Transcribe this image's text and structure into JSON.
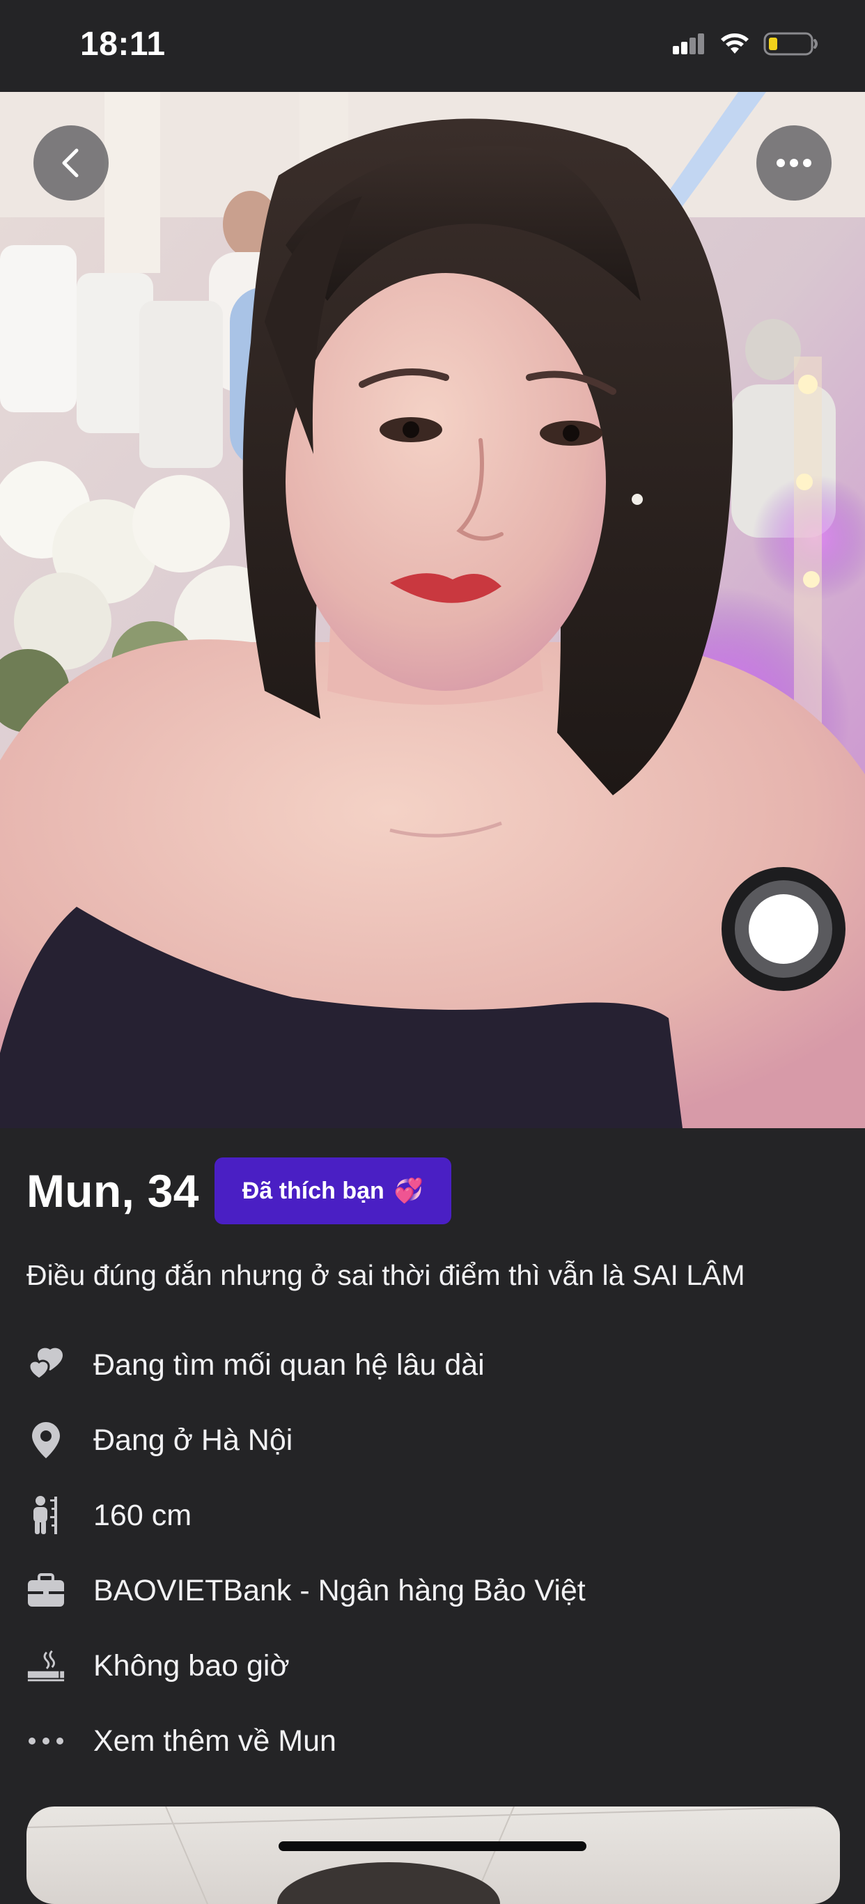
{
  "status_bar": {
    "time": "18:11"
  },
  "photo": {
    "back_icon": "chevron-left-icon",
    "more_icon": "ellipsis-icon"
  },
  "profile": {
    "name_age": "Mun, 34",
    "liked_badge": "Đã thích bạn",
    "liked_badge_emoji": "💞",
    "bio": "Điều đúng đắn nhưng ở sai thời điểm thì vẫn là SAI LÂM",
    "details": [
      {
        "icon": "hearts-icon",
        "text": "Đang tìm mối quan hệ lâu dài"
      },
      {
        "icon": "location-pin-icon",
        "text": "Đang ở Hà Nội"
      },
      {
        "icon": "height-icon",
        "text": "160 cm"
      },
      {
        "icon": "briefcase-icon",
        "text": "BAOVIETBank - Ngân hàng Bảo Việt"
      },
      {
        "icon": "smoking-icon",
        "text": "Không bao giờ"
      },
      {
        "icon": "more-dots-icon",
        "text": "Xem thêm về Mun"
      }
    ]
  },
  "colors": {
    "background": "#242426",
    "badge": "#4a1fc4",
    "text": "#ffffff",
    "icon": "#c9c9cd"
  }
}
